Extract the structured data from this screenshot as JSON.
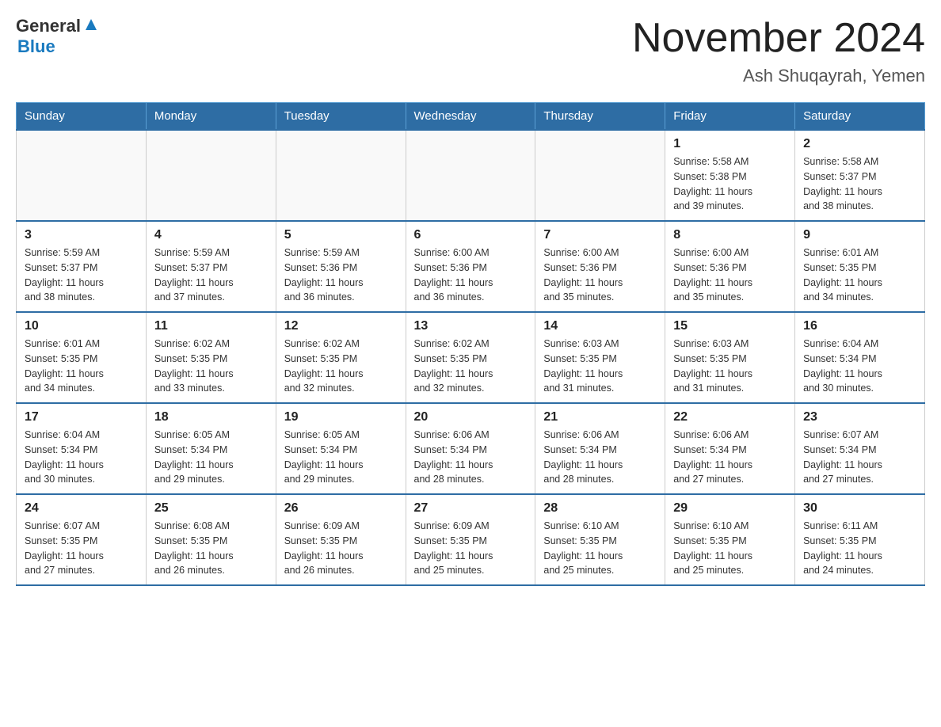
{
  "header": {
    "logo_general": "General",
    "logo_blue": "Blue",
    "title": "November 2024",
    "subtitle": "Ash Shuqayrah, Yemen"
  },
  "days_of_week": [
    "Sunday",
    "Monday",
    "Tuesday",
    "Wednesday",
    "Thursday",
    "Friday",
    "Saturday"
  ],
  "weeks": [
    {
      "days": [
        {
          "date": "",
          "info": ""
        },
        {
          "date": "",
          "info": ""
        },
        {
          "date": "",
          "info": ""
        },
        {
          "date": "",
          "info": ""
        },
        {
          "date": "",
          "info": ""
        },
        {
          "date": "1",
          "info": "Sunrise: 5:58 AM\nSunset: 5:38 PM\nDaylight: 11 hours\nand 39 minutes."
        },
        {
          "date": "2",
          "info": "Sunrise: 5:58 AM\nSunset: 5:37 PM\nDaylight: 11 hours\nand 38 minutes."
        }
      ]
    },
    {
      "days": [
        {
          "date": "3",
          "info": "Sunrise: 5:59 AM\nSunset: 5:37 PM\nDaylight: 11 hours\nand 38 minutes."
        },
        {
          "date": "4",
          "info": "Sunrise: 5:59 AM\nSunset: 5:37 PM\nDaylight: 11 hours\nand 37 minutes."
        },
        {
          "date": "5",
          "info": "Sunrise: 5:59 AM\nSunset: 5:36 PM\nDaylight: 11 hours\nand 36 minutes."
        },
        {
          "date": "6",
          "info": "Sunrise: 6:00 AM\nSunset: 5:36 PM\nDaylight: 11 hours\nand 36 minutes."
        },
        {
          "date": "7",
          "info": "Sunrise: 6:00 AM\nSunset: 5:36 PM\nDaylight: 11 hours\nand 35 minutes."
        },
        {
          "date": "8",
          "info": "Sunrise: 6:00 AM\nSunset: 5:36 PM\nDaylight: 11 hours\nand 35 minutes."
        },
        {
          "date": "9",
          "info": "Sunrise: 6:01 AM\nSunset: 5:35 PM\nDaylight: 11 hours\nand 34 minutes."
        }
      ]
    },
    {
      "days": [
        {
          "date": "10",
          "info": "Sunrise: 6:01 AM\nSunset: 5:35 PM\nDaylight: 11 hours\nand 34 minutes."
        },
        {
          "date": "11",
          "info": "Sunrise: 6:02 AM\nSunset: 5:35 PM\nDaylight: 11 hours\nand 33 minutes."
        },
        {
          "date": "12",
          "info": "Sunrise: 6:02 AM\nSunset: 5:35 PM\nDaylight: 11 hours\nand 32 minutes."
        },
        {
          "date": "13",
          "info": "Sunrise: 6:02 AM\nSunset: 5:35 PM\nDaylight: 11 hours\nand 32 minutes."
        },
        {
          "date": "14",
          "info": "Sunrise: 6:03 AM\nSunset: 5:35 PM\nDaylight: 11 hours\nand 31 minutes."
        },
        {
          "date": "15",
          "info": "Sunrise: 6:03 AM\nSunset: 5:35 PM\nDaylight: 11 hours\nand 31 minutes."
        },
        {
          "date": "16",
          "info": "Sunrise: 6:04 AM\nSunset: 5:34 PM\nDaylight: 11 hours\nand 30 minutes."
        }
      ]
    },
    {
      "days": [
        {
          "date": "17",
          "info": "Sunrise: 6:04 AM\nSunset: 5:34 PM\nDaylight: 11 hours\nand 30 minutes."
        },
        {
          "date": "18",
          "info": "Sunrise: 6:05 AM\nSunset: 5:34 PM\nDaylight: 11 hours\nand 29 minutes."
        },
        {
          "date": "19",
          "info": "Sunrise: 6:05 AM\nSunset: 5:34 PM\nDaylight: 11 hours\nand 29 minutes."
        },
        {
          "date": "20",
          "info": "Sunrise: 6:06 AM\nSunset: 5:34 PM\nDaylight: 11 hours\nand 28 minutes."
        },
        {
          "date": "21",
          "info": "Sunrise: 6:06 AM\nSunset: 5:34 PM\nDaylight: 11 hours\nand 28 minutes."
        },
        {
          "date": "22",
          "info": "Sunrise: 6:06 AM\nSunset: 5:34 PM\nDaylight: 11 hours\nand 27 minutes."
        },
        {
          "date": "23",
          "info": "Sunrise: 6:07 AM\nSunset: 5:34 PM\nDaylight: 11 hours\nand 27 minutes."
        }
      ]
    },
    {
      "days": [
        {
          "date": "24",
          "info": "Sunrise: 6:07 AM\nSunset: 5:35 PM\nDaylight: 11 hours\nand 27 minutes."
        },
        {
          "date": "25",
          "info": "Sunrise: 6:08 AM\nSunset: 5:35 PM\nDaylight: 11 hours\nand 26 minutes."
        },
        {
          "date": "26",
          "info": "Sunrise: 6:09 AM\nSunset: 5:35 PM\nDaylight: 11 hours\nand 26 minutes."
        },
        {
          "date": "27",
          "info": "Sunrise: 6:09 AM\nSunset: 5:35 PM\nDaylight: 11 hours\nand 25 minutes."
        },
        {
          "date": "28",
          "info": "Sunrise: 6:10 AM\nSunset: 5:35 PM\nDaylight: 11 hours\nand 25 minutes."
        },
        {
          "date": "29",
          "info": "Sunrise: 6:10 AM\nSunset: 5:35 PM\nDaylight: 11 hours\nand 25 minutes."
        },
        {
          "date": "30",
          "info": "Sunrise: 6:11 AM\nSunset: 5:35 PM\nDaylight: 11 hours\nand 24 minutes."
        }
      ]
    }
  ]
}
